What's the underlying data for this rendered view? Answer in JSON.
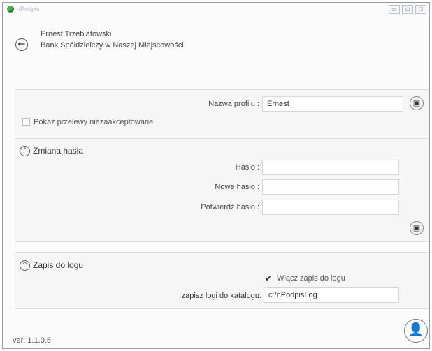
{
  "window": {
    "title": "nPodpis",
    "minimize_label": "▭",
    "maximize_label": "⊡",
    "close_label": "☐"
  },
  "header": {
    "back_label": "←",
    "user_name": "Ernest  Trzebiatowski",
    "bank_name": "Bank Spółdzielczy w Naszej Miejscowości"
  },
  "profile": {
    "name_label": "Nazwa profilu :",
    "name_value": "Ernest",
    "save_label": "💾",
    "show_unaccepted_label": "Pokaż przelewy niezaakceptowane",
    "show_unaccepted_checked": false
  },
  "password": {
    "section_title": "Zmiana hasła",
    "collapse_label": "^",
    "current_label": "Hasło :",
    "new_label": "Nowe hasło :",
    "confirm_label": "Potwierdź hasło :",
    "current_value": "",
    "new_value": "",
    "confirm_value": "",
    "save_label": "💾"
  },
  "log": {
    "section_title": "Zapis do logu",
    "collapse_label": "^",
    "enable_label": "Włącz zapis do logu",
    "enable_checked": true,
    "checkmark": "✔",
    "dir_label": "zapisz logi do katalogu:",
    "dir_value": "c:/nPodpisLog"
  },
  "footer": {
    "version": "ver: 1.1.0.5",
    "logout_icon": "👤",
    "logout_x": "×"
  }
}
